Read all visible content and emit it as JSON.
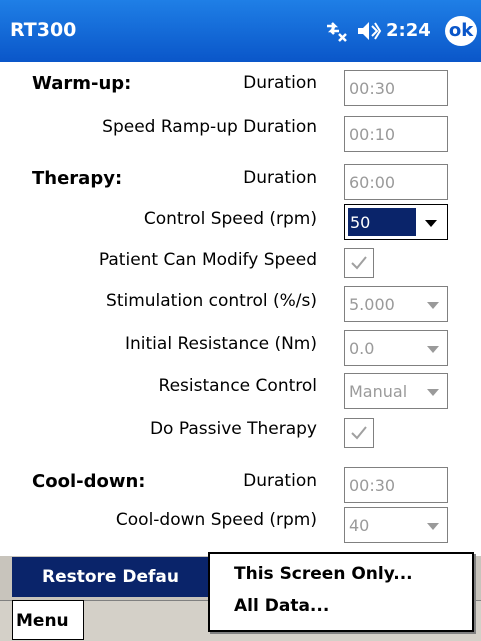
{
  "app": {
    "title": "RT300",
    "time": "2:24",
    "ok_label": "ok",
    "signal_icon": "signal-x-icon",
    "speaker_icon": "speaker-icon"
  },
  "warmup": {
    "heading": "Warm-up:",
    "duration_label": "Duration",
    "duration_value": "00:30",
    "ramp_label": "Speed Ramp-up Duration",
    "ramp_value": "00:10"
  },
  "therapy": {
    "heading": "Therapy:",
    "duration_label": "Duration",
    "duration_value": "60:00",
    "control_speed_label": "Control Speed (rpm)",
    "control_speed_value": "50",
    "patient_modify_label": "Patient Can Modify Speed",
    "patient_modify_checked": true,
    "stimulation_label": "Stimulation control (%/s)",
    "stimulation_value": "5.000",
    "initial_resistance_label": "Initial Resistance (Nm)",
    "initial_resistance_value": "0.0",
    "resistance_control_label": "Resistance Control",
    "resistance_control_value": "Manual",
    "passive_label": "Do Passive Therapy",
    "passive_checked": true
  },
  "cooldown": {
    "heading": "Cool-down:",
    "duration_label": "Duration",
    "duration_value": "00:30",
    "speed_label": "Cool-down Speed (rpm)",
    "speed_value": "40"
  },
  "bottom": {
    "restore_label": "Restore Defau",
    "menu_label": "Menu"
  },
  "popup": {
    "items": [
      "This Screen Only...",
      "All Data..."
    ]
  },
  "colors": {
    "titlebar": "#0a56c9",
    "selection": "#0a246a"
  }
}
